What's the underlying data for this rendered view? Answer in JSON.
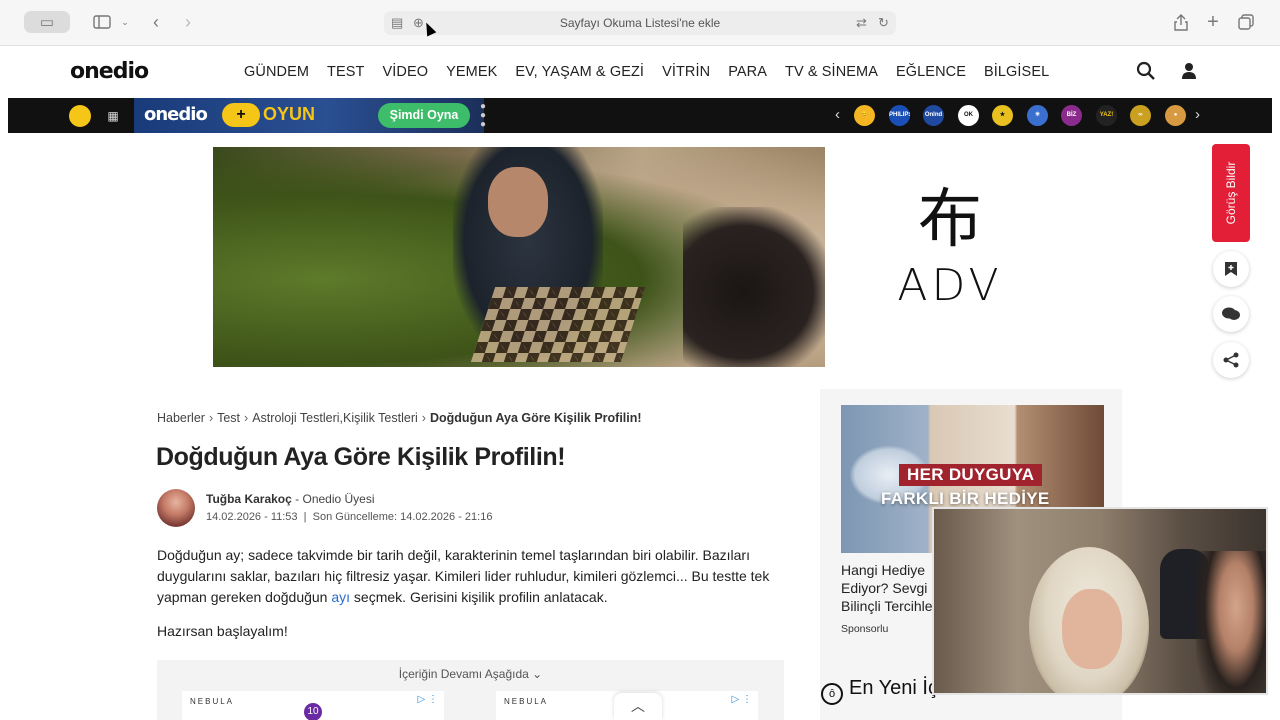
{
  "browser": {
    "address_text": "Sayfayı Okuma Listesi'ne ekle",
    "icons": [
      "sidebar-icon",
      "back-icon",
      "forward-icon",
      "reader-icon",
      "zoom-icon",
      "translate-icon",
      "reload-icon",
      "share-icon",
      "new-tab-icon",
      "tabs-icon"
    ]
  },
  "site": {
    "logo": "onedio",
    "nav": [
      "GÜNDEM",
      "TEST",
      "VİDEO",
      "YEMEK",
      "EV, YAŞAM & GEZİ",
      "VİTRİN",
      "PARA",
      "TV & SİNEMA",
      "EĞLENCE",
      "BİLGİSEL"
    ]
  },
  "gamebar": {
    "logo": "onedio",
    "oyun": "OYUN",
    "play_label": "Şimdi Oyna",
    "games": [
      "😊",
      "PHILIPS",
      "Onlnd",
      "OK",
      "★",
      "✳",
      "BİZ POP",
      "YAZ!",
      "∞",
      "●"
    ]
  },
  "ad": {
    "glyph": "布",
    "brand": "ADV"
  },
  "floating": {
    "feedback": "Görüş Bildir"
  },
  "article": {
    "breadcrumb": [
      "Haberler",
      "Test",
      "Astroloji Testleri,Kişilik Testleri",
      "Doğduğun Aya Göre Kişilik Profilin!"
    ],
    "title": "Doğduğun Aya Göre Kişilik Profilin!",
    "author_name": "Tuğba Karakoç",
    "author_role": "- Onedio Üyesi",
    "date": "14.02.2026 - 11:53",
    "updated": "Son Güncelleme: 14.02.2026 - 21:16",
    "intro_1": "Doğduğun ay; sadece takvimde bir tarih değil, karakterinin temel taşlarından biri olabilir. Bazıları duygularını saklar, bazıları hiç filtresiz yaşar. Kimileri lider ruhludur, kimileri gözlemci... Bu testte tek yapman gereken doğduğun ",
    "intro_link": "ayı",
    "intro_2": " seçmek. Gerisini kişilik profilin anlatacak.",
    "ready": "Hazırsan başlayalım!",
    "continue": "İçeriğin Devamı Aşağıda",
    "nebula": "NEBULA",
    "nebula_badge": "10"
  },
  "sidebar": {
    "banner_line1": "HER DUYGUYA",
    "banner_line2": "FARKLI BİR HEDİYE",
    "sponsored_text": "Hangi Hediye Ediyor? Sevgi Bilinçli Tercihle",
    "sponsored_label": "Sponsorlu",
    "latest": "En Yeni İçerikler"
  }
}
